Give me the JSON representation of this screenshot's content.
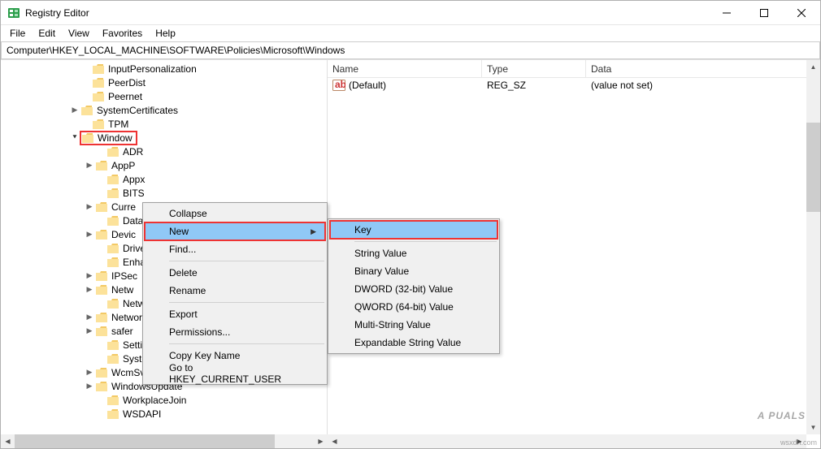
{
  "titlebar": {
    "title": "Registry Editor"
  },
  "menu": {
    "file": "File",
    "edit": "Edit",
    "view": "View",
    "favorites": "Favorites",
    "help": "Help"
  },
  "address": "Computer\\HKEY_LOCAL_MACHINE\\SOFTWARE\\Policies\\Microsoft\\Windows",
  "tree": {
    "n0": "InputPersonalization",
    "n1": "PeerDist",
    "n2": "Peernet",
    "n3": "SystemCertificates",
    "n4": "TPM",
    "n5": "Window",
    "n6": "ADR",
    "n7": "AppP",
    "n8": "Appx",
    "n9": "BITS",
    "n10": "Curre",
    "n11": "DataC",
    "n12": "Devic",
    "n13": "Drive",
    "n14": "Enha",
    "n15": "IPSec",
    "n16": "Netw",
    "n17": "Netw",
    "n18": "NetworkProvider",
    "n19": "safer",
    "n20": "SettingSync",
    "n21": "System",
    "n22": "WcmSvc",
    "n23": "WindowsUpdate",
    "n24": "WorkplaceJoin",
    "n25": "WSDAPI"
  },
  "list": {
    "col_name": "Name",
    "col_type": "Type",
    "col_data": "Data",
    "row0": {
      "name": "(Default)",
      "type": "REG_SZ",
      "data": "(value not set)"
    }
  },
  "cm1": {
    "collapse": "Collapse",
    "new": "New",
    "find": "Find...",
    "delete": "Delete",
    "rename": "Rename",
    "export": "Export",
    "permissions": "Permissions...",
    "copykey": "Copy Key Name",
    "gotohkcu": "Go to HKEY_CURRENT_USER"
  },
  "cm2": {
    "key": "Key",
    "string": "String Value",
    "binary": "Binary Value",
    "dword": "DWORD (32-bit) Value",
    "qword": "QWORD (64-bit) Value",
    "multi": "Multi-String Value",
    "expand": "Expandable String Value"
  },
  "watermark": "A  PUALS",
  "corner_url": "wsxdn.com"
}
